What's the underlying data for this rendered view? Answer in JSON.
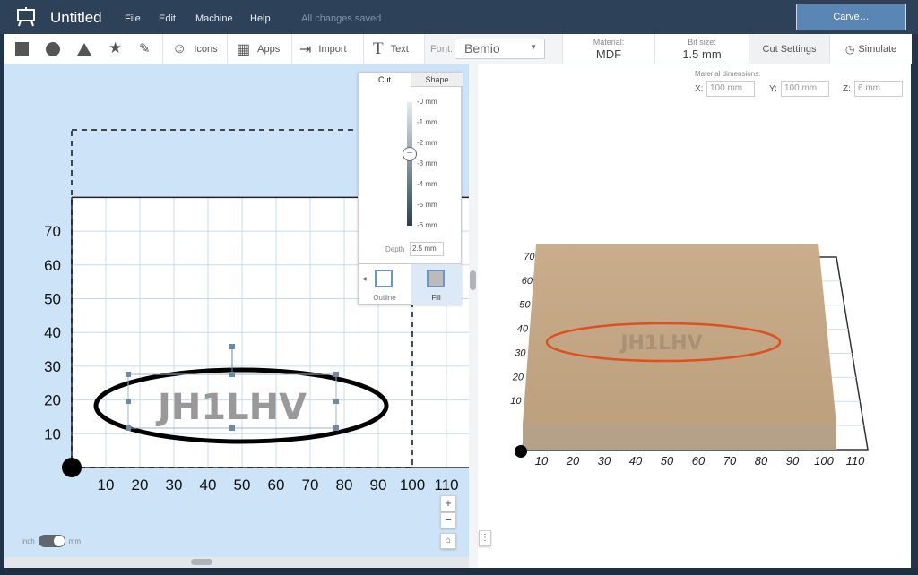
{
  "app": {
    "title": "Untitled",
    "menu": [
      "File",
      "Edit",
      "Machine",
      "Help"
    ],
    "status": "All changes saved",
    "carve_label": "Carve…"
  },
  "toolbar": {
    "icons_label": "Icons",
    "apps_label": "Apps",
    "import_label": "Import",
    "text_label": "Text",
    "font_label": "Font:",
    "font_value": "Bemio",
    "material_label": "Material:",
    "material_value": "MDF",
    "bit_label": "Bit size:",
    "bit_value": "1.5 mm",
    "cut_settings_label": "Cut Settings",
    "simulate_label": "Simulate"
  },
  "cut_panel": {
    "tabs": [
      "Cut",
      "Shape"
    ],
    "active_tab": "Cut",
    "depth_ticks": [
      "-0 mm",
      "-1 mm",
      "-2 mm",
      "-3 mm",
      "-4 mm",
      "-5 mm",
      "-6 mm"
    ],
    "depth_label": "Depth",
    "depth_value": "2.5 mm",
    "outline_label": "Outline",
    "fill_label": "Fill",
    "selected_mode": "Fill"
  },
  "canvas": {
    "design_text": "JH1LHV",
    "x_ticks": [
      "10",
      "20",
      "30",
      "40",
      "50",
      "60",
      "70",
      "80",
      "90",
      "100",
      "110"
    ],
    "y_ticks": [
      "10",
      "20",
      "30",
      "40",
      "50",
      "60",
      "70"
    ],
    "unit_left": "inch",
    "unit_right": "mm",
    "unit_selected": "mm",
    "zoom_in": "+",
    "zoom_out": "−"
  },
  "preview": {
    "material_dims_label": "Material dimensions:",
    "x_label": "X:",
    "x_value": "100 mm",
    "y_label": "Y:",
    "y_value": "100 mm",
    "z_label": "Z:",
    "z_value": "6 mm",
    "x_ticks": [
      "10",
      "20",
      "30",
      "40",
      "50",
      "60",
      "70",
      "80",
      "90",
      "100",
      "110"
    ],
    "y_ticks": [
      "10",
      "20",
      "30",
      "40",
      "50",
      "60",
      "70"
    ],
    "material_color": "#c8ad8a",
    "cut_color": "#e0501e"
  }
}
